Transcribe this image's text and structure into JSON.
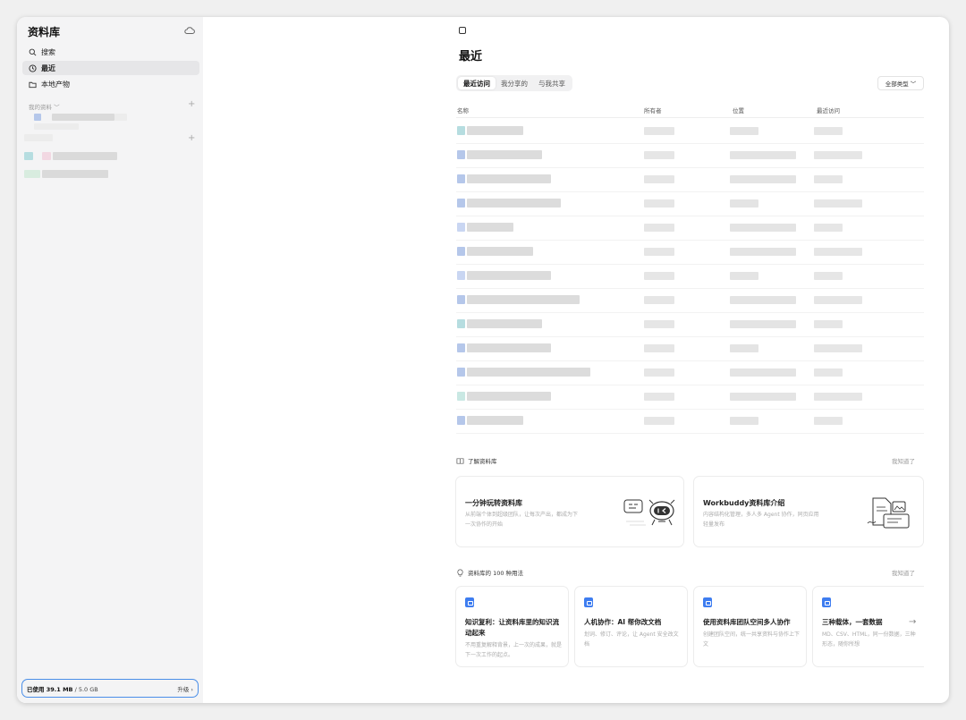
{
  "sidebar": {
    "title": "资料库",
    "nav": [
      {
        "label": "搜索",
        "icon": "search-icon"
      },
      {
        "label": "最近",
        "icon": "clock-icon",
        "active": true
      },
      {
        "label": "本地产物",
        "icon": "folder-icon"
      }
    ],
    "my_section_label": "我的资料 ﹀",
    "storage": {
      "used": "已使用 39.1 MB",
      "total": "/ 5.0 GB",
      "upgrade": "升级 ›"
    }
  },
  "main": {
    "title": "最近",
    "tabs": [
      {
        "label": "最近访问",
        "active": true
      },
      {
        "label": "我分享的"
      },
      {
        "label": "与我共享"
      }
    ],
    "filter_label": "全部类型 ﹀",
    "columns": [
      "名称",
      "所有者",
      "位置",
      "最近访问"
    ]
  },
  "learn": {
    "heading": "了解资料库",
    "dismiss": "我知道了",
    "cards": [
      {
        "title": "一分钟玩转资料库",
        "desc": "从前端个体到超级团队，让每次产出，都成为下一次协作的开始"
      },
      {
        "title": "Workbuddy资料库介绍",
        "desc": "内容结构化管理，多人多 Agent 协作，同页应用轻量发布"
      }
    ]
  },
  "uses": {
    "heading": "资料库的 100 种用法",
    "dismiss": "我知道了",
    "cards": [
      {
        "title": "知识复利：让资料库里的知识流动起来",
        "desc": "不用重复解释背景，上一次的成果，就是下一次工作的起点。"
      },
      {
        "title": "人机协作：AI 帮你改文档",
        "desc": "划词、修订、评论，让 Agent 安全改文档"
      },
      {
        "title": "使用资料库团队空间多人协作",
        "desc": "创建团队空间，统一共享资料与协作上下文"
      },
      {
        "title": "三种载体，一套数据",
        "desc": "MD、CSV、HTML，同一份数据，三种形态，随你所想"
      }
    ]
  },
  "colors": {
    "accent": "#3e7df0",
    "storage_border": "#4a8ee8"
  }
}
